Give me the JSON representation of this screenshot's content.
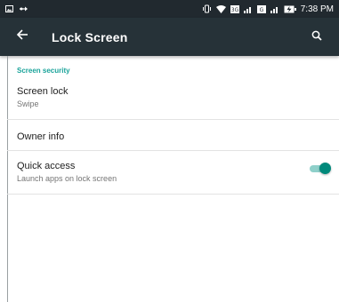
{
  "status_bar": {
    "time": "7:38 PM",
    "left_icons": [
      "gallery-notification-icon",
      "usb-debug-icon"
    ],
    "right_icons": [
      "vibrate-icon",
      "wifi-icon",
      "signal-3g-icon",
      "signal-bars-icon",
      "battery-charging-icon"
    ],
    "sim1_label": "3G",
    "sim2_label": "G"
  },
  "app_bar": {
    "title": "Lock Screen",
    "back_icon": "arrow-left-icon",
    "search_icon": "search-icon"
  },
  "settings": {
    "section_header": "Screen security",
    "screen_lock": {
      "title": "Screen lock",
      "summary": "Swipe"
    },
    "owner_info": {
      "title": "Owner info"
    },
    "quick_access": {
      "title": "Quick access",
      "summary": "Launch apps on lock screen",
      "enabled": true
    }
  },
  "colors": {
    "status_bar_bg": "#21292f",
    "app_bar_bg": "#263238",
    "accent": "#1aa39a",
    "toggle_thumb": "#00897b",
    "toggle_track": "#8fd0ca"
  }
}
